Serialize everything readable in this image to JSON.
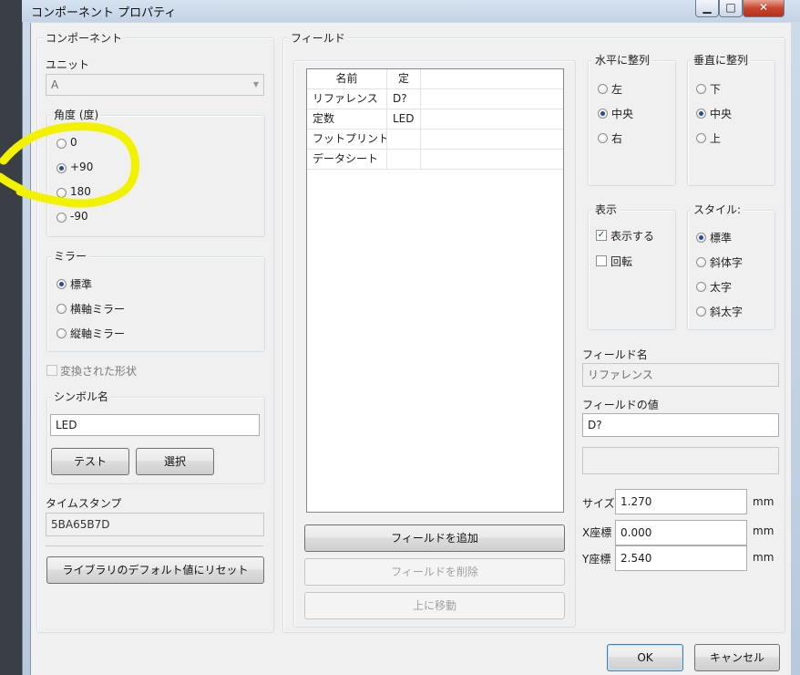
{
  "window": {
    "title": "コンポーネント プロパティ",
    "min": "▁",
    "max": "□",
    "close": "✕"
  },
  "component": {
    "title": "コンポーネント",
    "unit_label": "ユニット",
    "unit_value": "A",
    "angle": {
      "title": "角度 (度)",
      "options": [
        "0",
        "+90",
        "180",
        "-90"
      ],
      "selected": "+90"
    },
    "mirror": {
      "title": "ミラー",
      "options": [
        "標準",
        "横軸ミラー",
        "縦軸ミラー"
      ],
      "selected": "標準"
    },
    "converted_shape": "変換された形状",
    "symbol": {
      "title": "シンボル名",
      "value": "LED",
      "test": "テスト",
      "select": "選択"
    },
    "timestamp_label": "タイムスタンプ",
    "timestamp_value": "5BA65B7D",
    "reset_button": "ライブラリのデフォルト値にリセット"
  },
  "fields": {
    "title": "フィールド",
    "headers": [
      "名前",
      "定"
    ],
    "rows": [
      {
        "name": "リファレンス",
        "value": "D?"
      },
      {
        "name": "定数",
        "value": "LED"
      },
      {
        "name": "フットプリント",
        "value": ""
      },
      {
        "name": "データシート",
        "value": ""
      }
    ],
    "add": "フィールドを追加",
    "delete": "フィールドを削除",
    "move_up": "上に移動"
  },
  "align_h": {
    "title": "水平に整列",
    "options": [
      "左",
      "中央",
      "右"
    ],
    "selected": "中央"
  },
  "align_v": {
    "title": "垂直に整列",
    "options": [
      "下",
      "中央",
      "上"
    ],
    "selected": "中央"
  },
  "display": {
    "title": "表示",
    "show": "表示する",
    "show_checked": true,
    "rotate": "回転",
    "rotate_checked": false
  },
  "style": {
    "title": "スタイル:",
    "options": [
      "標準",
      "斜体字",
      "太字",
      "斜太字"
    ],
    "selected": "標準"
  },
  "field_name": {
    "label": "フィールド名",
    "value": "リファレンス"
  },
  "field_value": {
    "label": "フィールドの値",
    "value": "D?"
  },
  "size": {
    "label": "サイズ",
    "value": "1.270",
    "unit": "mm"
  },
  "pos_x": {
    "label": "X座標",
    "value": "0.000",
    "unit": "mm"
  },
  "pos_y": {
    "label": "Y座標",
    "value": "2.540",
    "unit": "mm"
  },
  "footer": {
    "ok": "OK",
    "cancel": "キャンセル"
  },
  "annotation_color": "#f2f200"
}
